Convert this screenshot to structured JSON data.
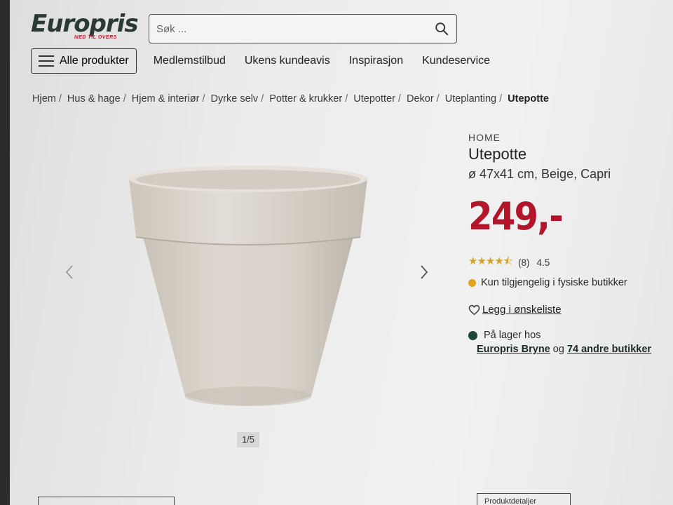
{
  "header": {
    "logo": "Europris",
    "logo_tagline": "MED TIL OVERS",
    "search_placeholder": "Søk ...",
    "menu_button": "Alle produkter",
    "nav_links": [
      "Medlemstilbud",
      "Ukens kundeavis",
      "Inspirasjon",
      "Kundeservice"
    ]
  },
  "breadcrumb": [
    "Hjem",
    "Hus & hage",
    "Hjem & interiør",
    "Dyrke selv",
    "Potter & krukker",
    "Utepotter",
    "Dekor",
    "Uteplanting",
    "Utepotte"
  ],
  "gallery": {
    "counter": "1/5",
    "prev_icon": "chevron-left-icon",
    "next_icon": "chevron-right-icon"
  },
  "product": {
    "brand": "HOME",
    "title": "Utepotte",
    "variant": "ø 47x41 cm, Beige, Capri",
    "price": "249,-",
    "rating_count": "(8)",
    "rating_value": "4.5",
    "availability": "Kun tilgjengelig i fysiske butikker",
    "wishlist": "Legg i ønskeliste",
    "stock_label": "På lager hos",
    "stock_store": "Europris Bryne",
    "stock_and": "og",
    "stock_others": "74 andre butikker"
  },
  "bottom": {
    "right_button": "Produktdetaljer"
  },
  "colors": {
    "price": "#b3162b",
    "logo": "#2c3a35",
    "stars": "#d4a22a",
    "availability_dot": "#e2a31d",
    "stock_dot": "#1e4536",
    "pot": "#d9d3cb"
  }
}
